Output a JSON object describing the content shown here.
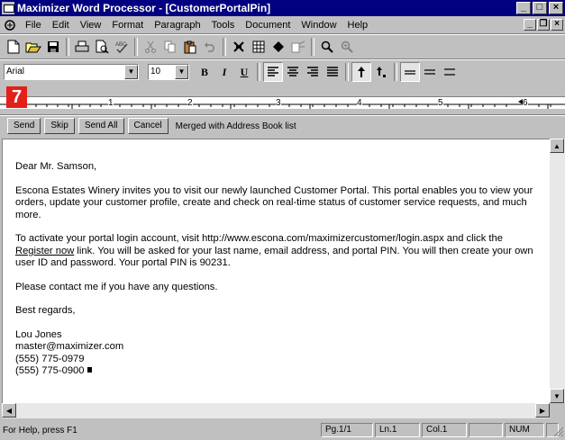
{
  "window": {
    "title": "Maximizer Word Processor - [CustomerPortalPin]"
  },
  "menu": {
    "items": [
      "File",
      "Edit",
      "View",
      "Format",
      "Paragraph",
      "Tools",
      "Document",
      "Window",
      "Help"
    ]
  },
  "format_bar": {
    "font": "Arial",
    "size": "10",
    "bold": "B",
    "italic": "I",
    "underline": "U"
  },
  "ruler": {
    "marks": [
      "1",
      "2",
      "3",
      "4",
      "5",
      "6"
    ]
  },
  "step_badge": "7",
  "merge_bar": {
    "send": "Send",
    "skip": "Skip",
    "send_all": "Send All",
    "cancel": "Cancel",
    "status": "Merged with Address Book list"
  },
  "letter": {
    "greeting": "Dear Mr. Samson,",
    "para1": "Escona Estates Winery invites you to visit our newly launched Customer Portal. This portal enables you to view your orders, update your customer profile, create and check on real-time status of customer service requests, and much more.",
    "para2_before": "To activate your portal login account, visit http://www.escona.com/maximizercustomer/login.aspx and click the ",
    "para2_link": "Register now",
    "para2_after": " link. You will be asked for your last name, email address, and portal PIN. You will then create your own user ID and password. Your portal PIN is 90231.",
    "para3": "Please contact me if you have any questions.",
    "closing": "Best regards,",
    "sig_name": "Lou Jones",
    "sig_email": "master@maximizer.com",
    "sig_phone1": "(555) 775-0979",
    "sig_phone2": "(555) 775-0900"
  },
  "status": {
    "help": "For Help, press F1",
    "page": "Pg.1/1",
    "line": "Ln.1",
    "col": "Col.1",
    "num": "NUM"
  },
  "colors": {
    "title_bar": "#000080",
    "badge": "#e4201a",
    "chrome": "#c0c0c0"
  }
}
